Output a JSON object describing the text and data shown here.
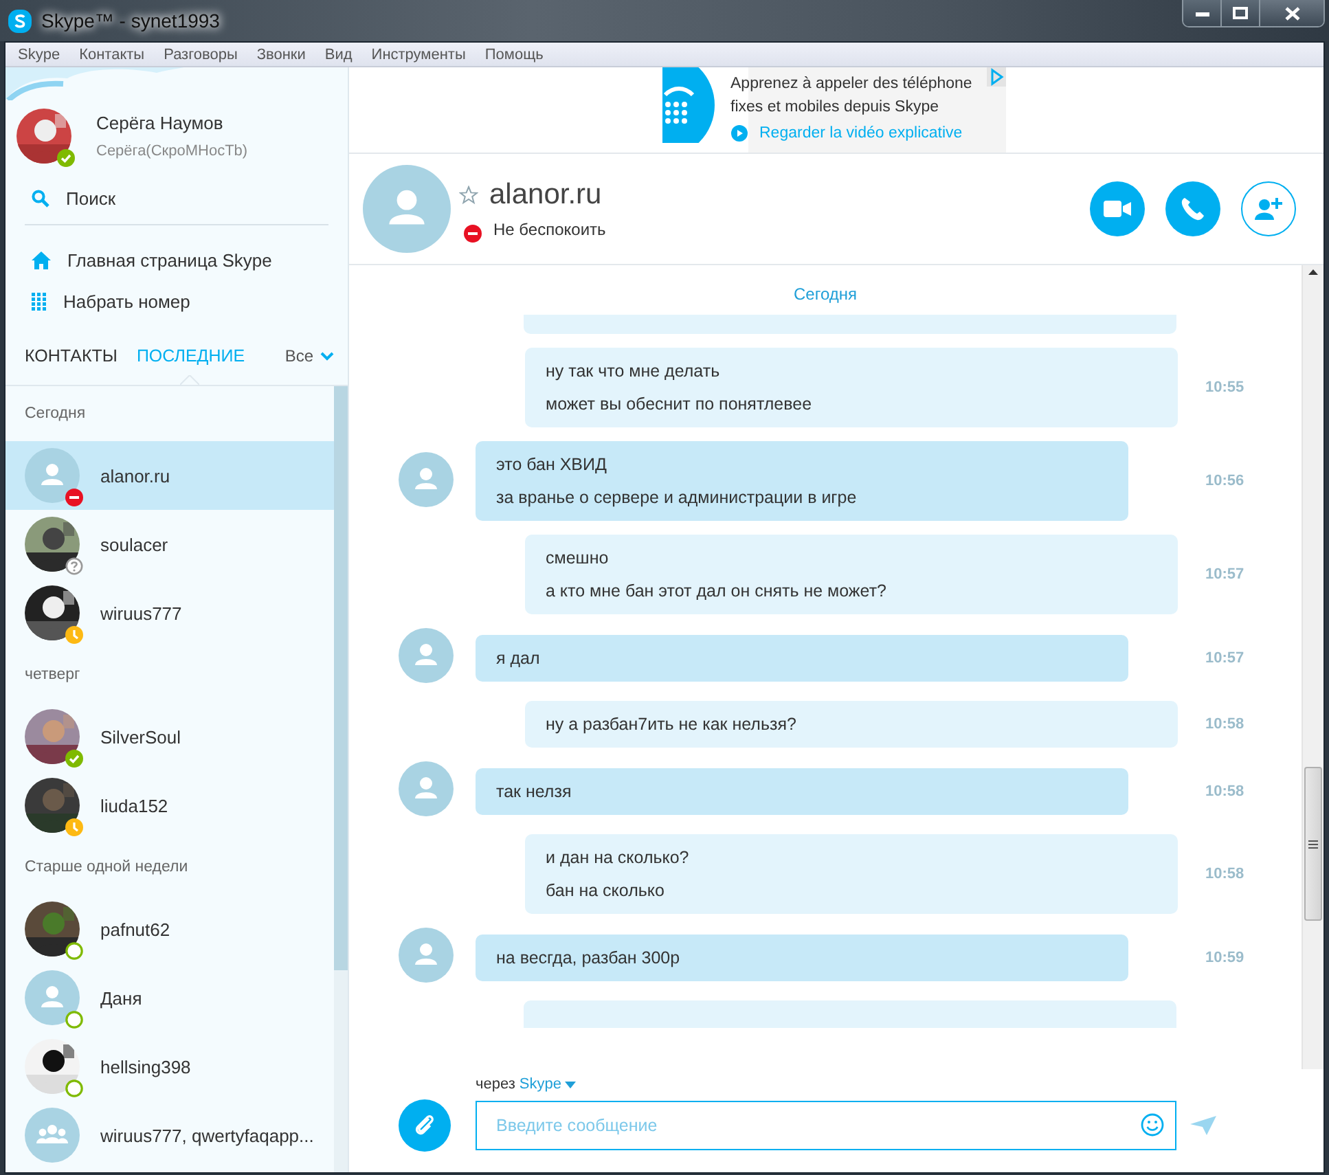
{
  "window": {
    "title": "Skype™ - synet1993"
  },
  "menu": [
    "Skype",
    "Контакты",
    "Разговоры",
    "Звонки",
    "Вид",
    "Инструменты",
    "Помощь"
  ],
  "profile": {
    "name": "Серёга Наумов",
    "mood": "Серёга(СкроМНосТb)",
    "status": {
      "kind": "online",
      "color": "#7fba00"
    }
  },
  "nav": [
    {
      "kind": "search",
      "label": "Поиск"
    },
    {
      "kind": "home",
      "label": "Главная страница Skype"
    },
    {
      "kind": "dial",
      "label": "Набрать номер"
    }
  ],
  "tabs": [
    {
      "label": "КОНТАКТЫ",
      "selected": false
    },
    {
      "label": "ПОСЛЕДНИЕ",
      "selected": true
    }
  ],
  "filter": "Все",
  "groups": [
    {
      "title": "Сегодня",
      "contacts": [
        {
          "name": "alanor.ru",
          "kind": "default",
          "status": {
            "kind": "dnd",
            "color": "#e81123"
          },
          "selected": true
        },
        {
          "name": "soulacer",
          "status": {
            "kind": "unknown",
            "color": "#999999"
          },
          "selected": false
        },
        {
          "name": "wiruus777",
          "status": {
            "kind": "away",
            "color": "#fdb913"
          },
          "selected": false
        }
      ]
    },
    {
      "title": "четверг",
      "contacts": [
        {
          "name": "SilverSoul",
          "status": {
            "kind": "online",
            "color": "#7fba00"
          },
          "selected": false
        },
        {
          "name": "liuda152",
          "status": {
            "kind": "away",
            "color": "#fdb913"
          },
          "selected": false
        }
      ]
    },
    {
      "title": "Старше одной недели",
      "contacts": [
        {
          "name": "pafnut62",
          "status": {
            "kind": "offline",
            "color": "#7fba00"
          },
          "selected": false
        },
        {
          "name": "Даня",
          "kind": "default",
          "status": {
            "kind": "offline",
            "color": "#7fba00"
          },
          "selected": false
        },
        {
          "name": "hellsing398",
          "status": {
            "kind": "offline",
            "color": "#7fba00"
          },
          "selected": false
        },
        {
          "name": "wiruus777, qwertyfaqapp...",
          "kind": "group",
          "selected": false
        }
      ]
    }
  ],
  "ad": {
    "lines": [
      "Apprenez à appeler des téléphone",
      "fixes et mobiles depuis Skype"
    ],
    "link": "Regarder la vidéo explicative"
  },
  "conversation": {
    "name": "alanor.ru",
    "status": {
      "kind": "dnd",
      "color": "#e81123"
    },
    "status_text": "Не беспокоить",
    "favorite": false
  },
  "chat": {
    "day": "Сегодня",
    "messages": [
      {
        "kind": "outgoing",
        "lines": [
          "ну так что мне делать",
          "может вы обеснит по понятлевее"
        ],
        "time": "10:55"
      },
      {
        "kind": "incoming",
        "lines": [
          "это бан ХВИД",
          "за вранье о сервере и администрации в игре"
        ],
        "time": "10:56"
      },
      {
        "kind": "outgoing",
        "lines": [
          "смешно",
          "а кто мне бан этот дал он снять не может?"
        ],
        "time": "10:57"
      },
      {
        "kind": "incoming",
        "lines": [
          "я дал"
        ],
        "time": "10:57"
      },
      {
        "kind": "outgoing",
        "lines": [
          "ну а разбан7ить не как нельзя?"
        ],
        "time": "10:58"
      },
      {
        "kind": "incoming",
        "lines": [
          "так нелзя"
        ],
        "time": "10:58"
      },
      {
        "kind": "outgoing",
        "lines": [
          "и дан на сколько?",
          "бан на сколько"
        ],
        "time": "10:58"
      },
      {
        "kind": "incoming",
        "lines": [
          "на весгда, разбан 300р"
        ],
        "time": "10:59"
      }
    ]
  },
  "compose": {
    "via_label": "через",
    "via": "Skype",
    "placeholder": "Введите сообщение"
  }
}
